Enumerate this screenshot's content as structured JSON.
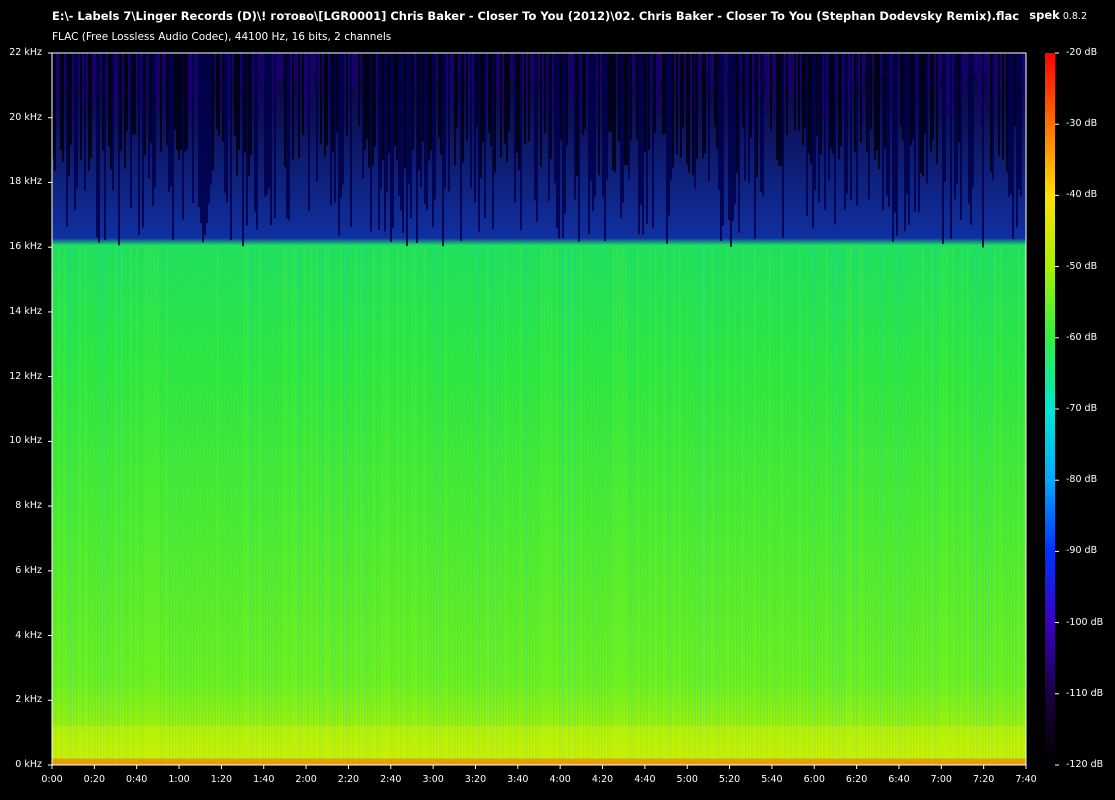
{
  "window": {
    "file_path": "E:\\- Labels 7\\Linger Records (D)\\! готово\\[LGR0001] Chris Baker - Closer To You (2012)\\02. Chris Baker - Closer To You (Stephan Dodevsky Remix).flac",
    "file_info": "FLAC (Free Lossless Audio Codec), 44100 Hz, 16 bits, 2 channels",
    "app_name": "spek",
    "app_version": "0.8.2"
  },
  "chart_data": {
    "type": "heatmap",
    "frequency_axis": {
      "unit": "kHz",
      "range": [
        0,
        22
      ],
      "ticks": [
        "0 kHz",
        "2 kHz",
        "4 kHz",
        "6 kHz",
        "8 kHz",
        "10 kHz",
        "12 kHz",
        "14 kHz",
        "16 kHz",
        "18 kHz",
        "20 kHz",
        "22 kHz"
      ]
    },
    "time_axis": {
      "range_seconds": [
        0,
        460
      ],
      "ticks": [
        "0:00",
        "0:20",
        "0:40",
        "1:00",
        "1:20",
        "1:40",
        "2:00",
        "2:20",
        "2:40",
        "3:00",
        "3:20",
        "3:40",
        "4:00",
        "4:20",
        "4:40",
        "5:00",
        "5:20",
        "5:40",
        "6:00",
        "6:20",
        "6:40",
        "7:00",
        "7:20",
        "7:40"
      ]
    },
    "color_scale": {
      "unit": "dB",
      "range": [
        -120,
        -20
      ],
      "ticks": [
        "-20 dB",
        "-30 dB",
        "-40 dB",
        "-50 dB",
        "-60 dB",
        "-70 dB",
        "-80 dB",
        "-90 dB",
        "-100 dB",
        "-110 dB",
        "-120 dB"
      ],
      "colors": [
        "#000000",
        "#1a0040",
        "#3a00c0",
        "#0030ff",
        "#00a8ff",
        "#00e8d0",
        "#30f040",
        "#a8f000",
        "#ffe000",
        "#ff7000",
        "#ff0000"
      ]
    },
    "cutoff_khz": 16
  }
}
